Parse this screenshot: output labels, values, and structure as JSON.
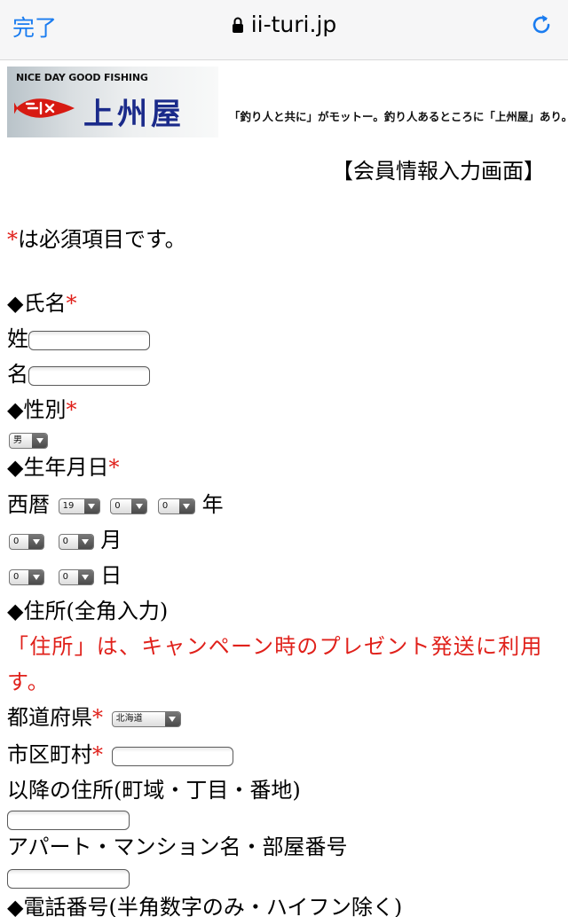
{
  "browser": {
    "done_label": "完了",
    "url": "ii-turi.jp",
    "icons": {
      "lock": "lock-icon",
      "reload": "reload-icon"
    },
    "accent_color": "#1a7cf0"
  },
  "banner": {
    "tagline": "NICE DAY GOOD FISHING",
    "shop_name": "上州屋",
    "motto": "「釣り人と共に」がモットー。釣り人あるところに「上州屋」あり。"
  },
  "page": {
    "heading": "【会員情報入力画面】",
    "required_mark": "*",
    "required_note": "は必須項目です。",
    "required_color": "#e0211b"
  },
  "form": {
    "name_section": "◆氏名",
    "last_name_label": "姓",
    "first_name_label": "名",
    "gender_section": "◆性別",
    "gender_value": "男",
    "birth_section": "◆生年月日",
    "seireki_label": "西暦",
    "year_selects": [
      "19",
      "0",
      "0"
    ],
    "year_unit": "年",
    "month_selects": [
      "0",
      "0"
    ],
    "month_unit": "月",
    "day_selects": [
      "0",
      "0"
    ],
    "day_unit": "日",
    "address_section": "◆住所(全角入力)",
    "address_notice_line1": "「住所」は、キャンペーン時のプレゼント発送に利用",
    "address_notice_line2": "す。",
    "prefecture_label": "都道府県",
    "prefecture_value": "北海道",
    "city_label": "市区町村",
    "street_label": "以降の住所(町域・丁目・番地)",
    "building_label": "アパート・マンション名・部屋番号",
    "phone_section": "◆電話番号(半角数字のみ・ハイフン除く)"
  }
}
